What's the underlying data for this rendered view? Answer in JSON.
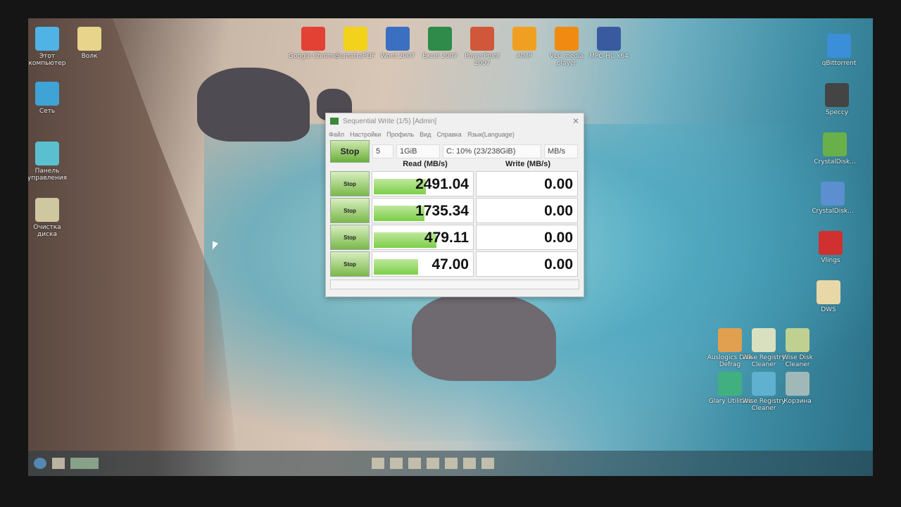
{
  "desktop": {
    "left_icons": [
      {
        "label": "Этот компьютер",
        "color": "#4fb3e6"
      },
      {
        "label": "Волк",
        "color": "#e8d48a"
      },
      {
        "label": "Сеть",
        "color": "#3fa3d6"
      },
      {
        "label": "Панель управления",
        "color": "#5ac0d0"
      },
      {
        "label": "Очистка диска",
        "color": "#cfc7a0"
      }
    ],
    "top_icons": [
      {
        "label": "Google Chrome",
        "color": "#e34133"
      },
      {
        "label": "SumatraPDF",
        "color": "#f2d21b"
      },
      {
        "label": "Word 2007",
        "color": "#3b6fc2"
      },
      {
        "label": "Excel 2007",
        "color": "#2e8b4a"
      },
      {
        "label": "PowerPoint 2007",
        "color": "#d0573a"
      },
      {
        "label": "AIMP",
        "color": "#f0a020"
      },
      {
        "label": "VLC media player",
        "color": "#f08a10"
      },
      {
        "label": "MPC-HC x64",
        "color": "#3a5aa0"
      }
    ],
    "right_icons": [
      {
        "label": "qBittorrent",
        "color": "#3a8fd8"
      },
      {
        "label": "Speccy",
        "color": "#444"
      },
      {
        "label": "CrystalDisk...",
        "color": "#6ab04a"
      },
      {
        "label": "CrystalDisk...",
        "color": "#5b8fd0"
      },
      {
        "label": "Vlings",
        "color": "#d03030"
      },
      {
        "label": "DWS",
        "color": "#e8d8a8"
      }
    ],
    "bottom_icons": [
      {
        "label": "Auslogics Disk Defrag",
        "color": "#e0a050"
      },
      {
        "label": "Wise Registry Cleaner",
        "color": "#d8e0c0"
      },
      {
        "label": "Wise Disk Cleaner",
        "color": "#c0d090"
      },
      {
        "label": "Glary Utilities",
        "color": "#40b080"
      },
      {
        "label": "Wise Registry Cleaner",
        "color": "#60b0d0"
      },
      {
        "label": "Корзина",
        "color": "#a0b8b8"
      }
    ]
  },
  "app": {
    "title": "Sequential Write (1/5) [Admin]",
    "close": "✕",
    "menu": [
      "Файл",
      "Настройки",
      "Профиль",
      "Вид",
      "Справка",
      "Язык(Language)"
    ],
    "stop_all": "Stop",
    "count": "5",
    "size": "1GiB",
    "drive": "C: 10% (23/238GiB)",
    "unit": "MB/s",
    "read_header": "Read (MB/s)",
    "write_header": "Write (MB/s)",
    "rows": [
      {
        "button": "Stop",
        "read": "2491.04",
        "write": "0.00",
        "read_fill": 0.52
      },
      {
        "button": "Stop",
        "read": "1735.34",
        "write": "0.00",
        "read_fill": 0.5
      },
      {
        "button": "Stop",
        "read": "479.11",
        "write": "0.00",
        "read_fill": 0.62
      },
      {
        "button": "Stop",
        "read": "47.00",
        "write": "0.00",
        "read_fill": 0.44
      }
    ]
  }
}
